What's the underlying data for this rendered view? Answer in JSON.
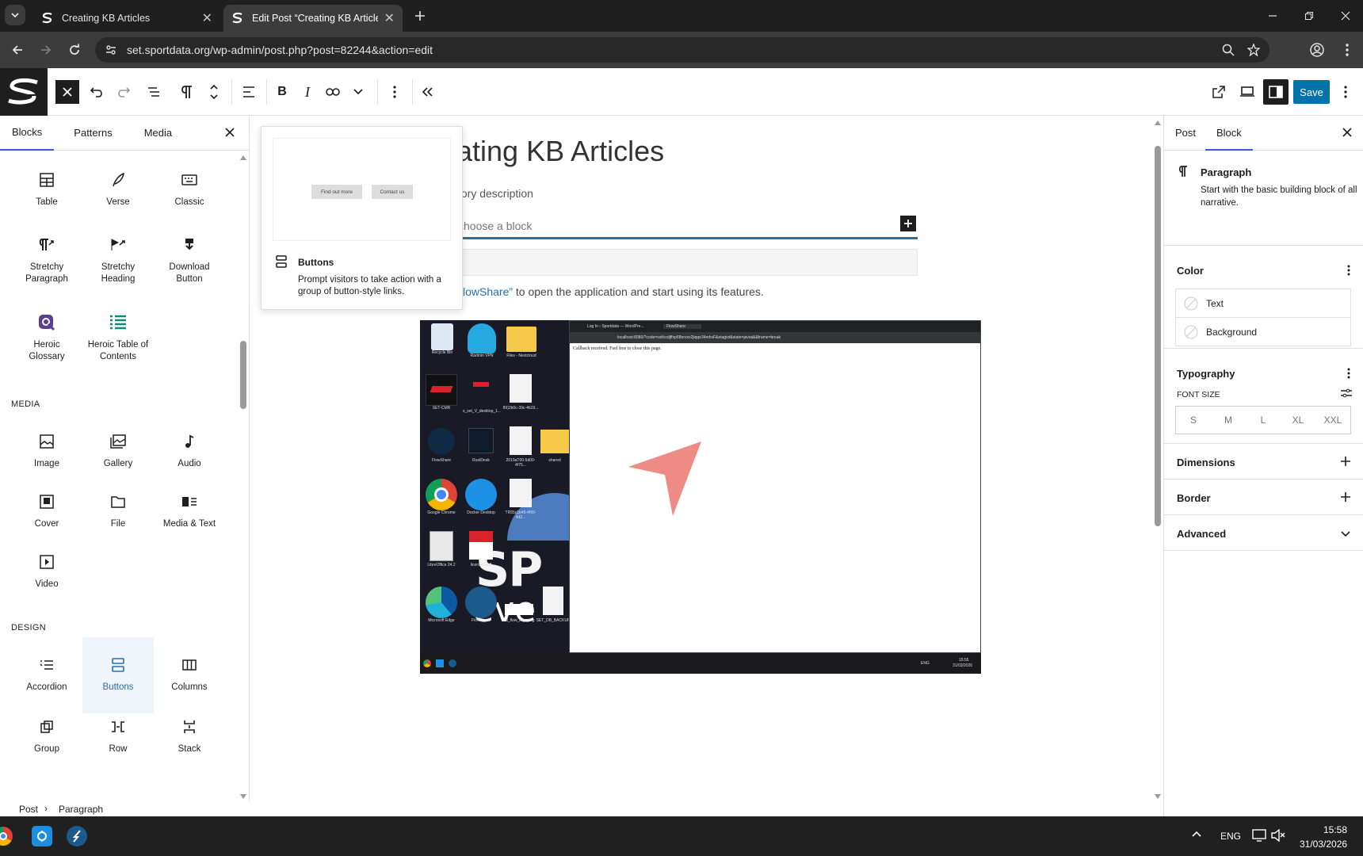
{
  "browser": {
    "tabs": [
      {
        "title": "Creating KB Articles"
      },
      {
        "title": "Edit Post “Creating KB Articles”"
      }
    ],
    "url": "set.sportdata.org/wp-admin/post.php?post=82244&action=edit"
  },
  "editor_toolbar": {
    "save_label": "Save"
  },
  "inserter": {
    "tabs": [
      "Blocks",
      "Patterns",
      "Media"
    ],
    "categories": {
      "media": "MEDIA",
      "design": "DESIGN"
    },
    "blocks": {
      "table": "Table",
      "verse": "Verse",
      "classic": "Classic",
      "stretchy_paragraph_1": "Stretchy",
      "stretchy_paragraph_2": "Paragraph",
      "stretchy_heading_1": "Stretchy",
      "stretchy_heading_2": "Heading",
      "download_button_1": "Download",
      "download_button_2": "Button",
      "heroic_glossary_1": "Heroic",
      "heroic_glossary_2": "Glossary",
      "heroic_toc_1": "Heroic Table of",
      "heroic_toc_2": "Contents",
      "image": "Image",
      "gallery": "Gallery",
      "audio": "Audio",
      "cover": "Cover",
      "file": "File",
      "media_text": "Media & Text",
      "video": "Video",
      "accordion": "Accordion",
      "buttons": "Buttons",
      "columns": "Columns",
      "group": "Group",
      "row": "Row",
      "stack": "Stack"
    }
  },
  "preview_popover": {
    "btn1": "Find out more",
    "btn2": "Contact us",
    "title": "Buttons",
    "description": "Prompt visitors to take action with a group of button-style links."
  },
  "canvas": {
    "title_fragment": "ating KB Articles",
    "description_fragment": "tory description",
    "placeholder_fragment": "choose a block",
    "para_link": "lowShare”",
    "para_rest": " to open the application and start using its features."
  },
  "screenshot": {
    "desktop_labels": [
      "Recycle Bin",
      "Radmin VPN",
      "Files - Nextcloud",
      "SET-CMR",
      "s_set_V_desktop_1...",
      "89)2b0c-39c-4b19...",
      "FlowShare",
      "RustDesk",
      "2019aT00-5d00-4f75...",
      "shared",
      "Google Chrome",
      "Docker Desktop",
      "TR55c1b49-4f99-4d2...",
      "LibreOffice 24.2",
      "licenses.pdf",
      "Microsoft Edge",
      "FlowShare",
      "cd_flow_logo.png",
      "SET_DB_BACKUP"
    ],
    "inner_tabs": [
      "Log In ‹ Sportdata — WordPre...",
      "FlowShare"
    ],
    "inner_url": "localhost:8080/?code=xxifcodjffxp6Bxrxxx2jiqqe34mhxF&etagtxt&state=javiat&&frame=break",
    "callback_text": "Callback received. Feel free to close this page.",
    "tray_time": "15:55",
    "tray_date": "31/03/2026",
    "tray_lang": "ENG"
  },
  "settings": {
    "tabs": [
      "Post",
      "Block"
    ],
    "block_name": "Paragraph",
    "block_desc": "Start with the basic building block of all narrative.",
    "color": {
      "heading": "Color",
      "text": "Text",
      "background": "Background"
    },
    "typography": {
      "heading": "Typography",
      "font_size_label": "FONT SIZE",
      "sizes": [
        "S",
        "M",
        "L",
        "XL",
        "XXL"
      ]
    },
    "dimensions": "Dimensions",
    "border": "Border",
    "advanced": "Advanced"
  },
  "breadcrumb": {
    "post": "Post",
    "separator": "›",
    "paragraph": "Paragraph"
  },
  "taskbar": {
    "time": "15:58",
    "date": "31/03/2026",
    "lang": "ENG"
  },
  "colors": {
    "accent": "#3858e9",
    "save": "#0073aa",
    "wp_blue": "#2271b1"
  }
}
